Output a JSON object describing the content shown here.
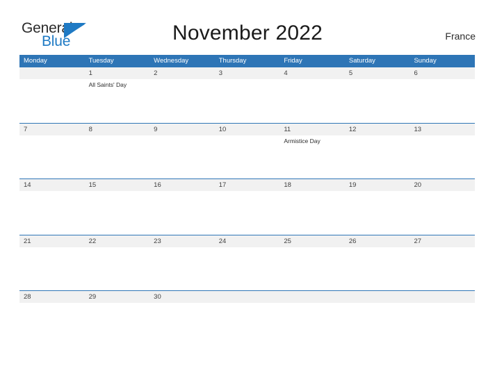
{
  "brand": {
    "name_part1": "General",
    "name_part2": "Blue",
    "flag_icon": "blue-triangle-flag-icon",
    "colors": {
      "text_dark": "#2b2b2b",
      "blue": "#1f7ac4"
    }
  },
  "header": {
    "title": "November 2022",
    "country": "France"
  },
  "theme": {
    "header_blue": "#2e75b6",
    "band_gray": "#f1f1f1",
    "rule_blue": "#2e75b6",
    "day_number_color": "#3f3f3f"
  },
  "weekdays": [
    {
      "label": "Monday"
    },
    {
      "label": "Tuesday"
    },
    {
      "label": "Wednesday"
    },
    {
      "label": "Thursday"
    },
    {
      "label": "Friday"
    },
    {
      "label": "Saturday"
    },
    {
      "label": "Sunday"
    }
  ],
  "weeks": [
    {
      "days": [
        {
          "number": "",
          "event": ""
        },
        {
          "number": "1",
          "event": "All Saints' Day"
        },
        {
          "number": "2",
          "event": ""
        },
        {
          "number": "3",
          "event": ""
        },
        {
          "number": "4",
          "event": ""
        },
        {
          "number": "5",
          "event": ""
        },
        {
          "number": "6",
          "event": ""
        }
      ]
    },
    {
      "days": [
        {
          "number": "7",
          "event": ""
        },
        {
          "number": "8",
          "event": ""
        },
        {
          "number": "9",
          "event": ""
        },
        {
          "number": "10",
          "event": ""
        },
        {
          "number": "11",
          "event": "Armistice Day"
        },
        {
          "number": "12",
          "event": ""
        },
        {
          "number": "13",
          "event": ""
        }
      ]
    },
    {
      "days": [
        {
          "number": "14",
          "event": ""
        },
        {
          "number": "15",
          "event": ""
        },
        {
          "number": "16",
          "event": ""
        },
        {
          "number": "17",
          "event": ""
        },
        {
          "number": "18",
          "event": ""
        },
        {
          "number": "19",
          "event": ""
        },
        {
          "number": "20",
          "event": ""
        }
      ]
    },
    {
      "days": [
        {
          "number": "21",
          "event": ""
        },
        {
          "number": "22",
          "event": ""
        },
        {
          "number": "23",
          "event": ""
        },
        {
          "number": "24",
          "event": ""
        },
        {
          "number": "25",
          "event": ""
        },
        {
          "number": "26",
          "event": ""
        },
        {
          "number": "27",
          "event": ""
        }
      ]
    },
    {
      "days": [
        {
          "number": "28",
          "event": ""
        },
        {
          "number": "29",
          "event": ""
        },
        {
          "number": "30",
          "event": ""
        },
        {
          "number": "",
          "event": ""
        },
        {
          "number": "",
          "event": ""
        },
        {
          "number": "",
          "event": ""
        },
        {
          "number": "",
          "event": ""
        }
      ]
    }
  ]
}
